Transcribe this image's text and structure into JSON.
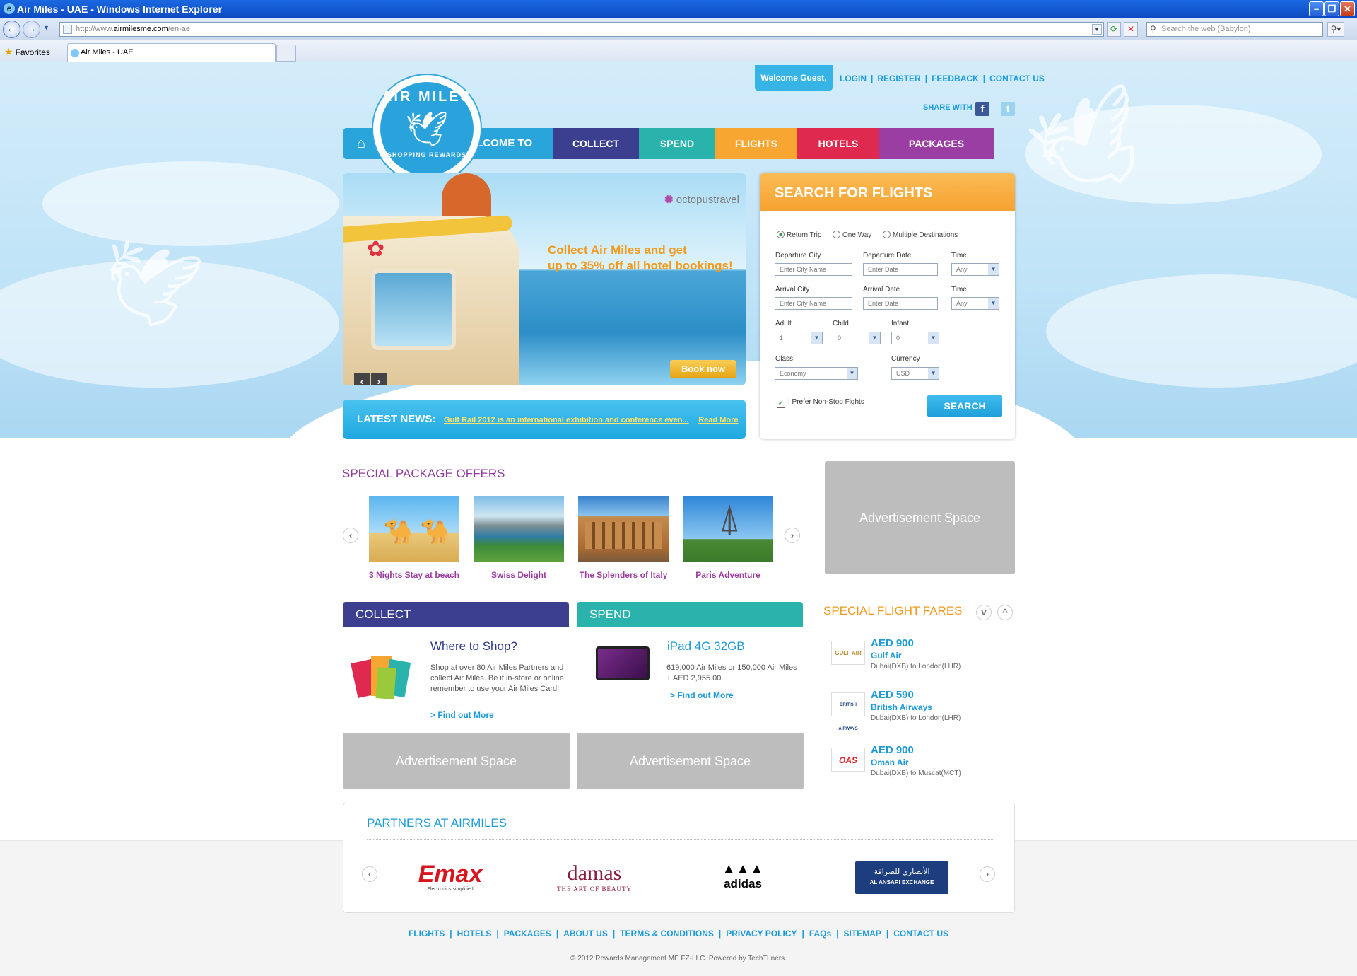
{
  "browser": {
    "window_title": "Air Miles - UAE - Windows Internet Explorer",
    "url_prefix": "http://www.",
    "url_domain": "airmilesme.com",
    "url_path": "/en-ae",
    "search_placeholder": "Search the web (Babylon)",
    "favorites_label": "Favorites",
    "tab_title": "Air Miles - UAE"
  },
  "header": {
    "welcome": "Welcome Guest,",
    "links": [
      "LOGIN",
      "REGISTER",
      "FEEDBACK",
      "CONTACT US"
    ],
    "share_label": "SHARE WITH",
    "logo_top": "AIR MILES",
    "logo_bottom": "SHOPPING REWARDS"
  },
  "nav": {
    "welcome": "WELCOME TO AIRMILES",
    "items": [
      {
        "label": "COLLECT",
        "color": "#3c3e8f"
      },
      {
        "label": "SPEND",
        "color": "#2ab3ad"
      },
      {
        "label": "FLIGHTS",
        "color": "#f7a731"
      },
      {
        "label": "HOTELS",
        "color": "#e0294f"
      },
      {
        "label": "PACKAGES",
        "color": "#9a3ea3"
      }
    ]
  },
  "banner": {
    "brand_a": "octopus",
    "brand_b": "travel",
    "promo_line1": "Collect Air Miles and get",
    "promo_line2": "up to 35% off all hotel bookings!",
    "book_label": "Book now"
  },
  "news": {
    "label": "LATEST NEWS:",
    "text": "Gulf Rail 2012 is an international exhibition and conference even...",
    "read_more": "Read More"
  },
  "flight_search": {
    "title": "SEARCH FOR FLIGHTS",
    "trip_types": [
      "Return Trip",
      "One Way",
      "Multiple Destinations"
    ],
    "selected_trip": "Return Trip",
    "departure_city_label": "Departure City",
    "departure_city_placeholder": "Enter City Name",
    "departure_date_label": "Departure Date",
    "departure_date_placeholder": "Enter Date",
    "time_label": "Time",
    "time_value": "Any",
    "arrival_city_label": "Arrival City",
    "arrival_city_placeholder": "Enter City Name",
    "arrival_date_label": "Arrival Date",
    "arrival_date_placeholder": "Enter Date",
    "adult_label": "Adult",
    "adult_value": "1",
    "child_label": "Child",
    "child_value": "0",
    "infant_label": "Infant",
    "infant_value": "0",
    "class_label": "Class",
    "class_value": "Economy",
    "currency_label": "Currency",
    "currency_value": "USD",
    "nonstop_label": "I Prefer Non-Stop Fights",
    "nonstop_checked": true,
    "search_label": "SEARCH"
  },
  "packages": {
    "title": "SPECIAL PACKAGE OFFERS",
    "items": [
      {
        "caption": "3 Nights Stay at beach",
        "icon": "camels-beach-image"
      },
      {
        "caption": "Swiss Delight",
        "icon": "swiss-lake-image"
      },
      {
        "caption": "The Splenders of Italy",
        "icon": "colosseum-image"
      },
      {
        "caption": "Paris Adventure",
        "icon": "eiffel-tower-image"
      }
    ]
  },
  "ads": {
    "label": "Advertisement Space"
  },
  "collect": {
    "header": "COLLECT",
    "title": "Where to Shop?",
    "body": "Shop at over 80 Air Miles Partners and collect Air Miles. Be it in-store or online remember to use your Air Miles Card!",
    "link": "> Find out More"
  },
  "spend": {
    "header": "SPEND",
    "title": "iPad 4G 32GB",
    "body": "619,000 Air Miles or 150,000 Air Miles + AED 2,955.00",
    "link": "> Find out More"
  },
  "fares": {
    "title": "SPECIAL FLIGHT FARES",
    "items": [
      {
        "amount": "AED 900",
        "airline": "Gulf Air",
        "route": "Dubai(DXB) to London(LHR)",
        "logo_text": "GULF AIR"
      },
      {
        "amount": "AED 590",
        "airline": "British Airways",
        "route": "Dubai(DXB) to London(LHR)",
        "logo_text": "BRITISH AIRWAYS"
      },
      {
        "amount": "AED 900",
        "airline": "Oman Air",
        "route": "Dubai(DXB) to Muscat(MCT)",
        "logo_text": "OAS"
      }
    ]
  },
  "partners": {
    "title": "PARTNERS AT AIRMILES",
    "logos": [
      {
        "name": "Emax",
        "sub": "Electronics simplified"
      },
      {
        "name": "damas",
        "sub": "THE ART OF BEAUTY"
      },
      {
        "name": "adidas",
        "sub": ""
      },
      {
        "name": "AL ANSARI EXCHANGE",
        "sub": "الأنصاري للصرافة"
      }
    ]
  },
  "footer": {
    "links": [
      "FLIGHTS",
      "HOTELS",
      "PACKAGES",
      "ABOUT US",
      "TERMS & CONDITIONS",
      "PRIVACY POLICY",
      "FAQs",
      "SITEMAP",
      "CONTACT US"
    ],
    "copyright": "© 2012 Rewards Management ME FZ-LLC. Powered by TechTuners."
  }
}
